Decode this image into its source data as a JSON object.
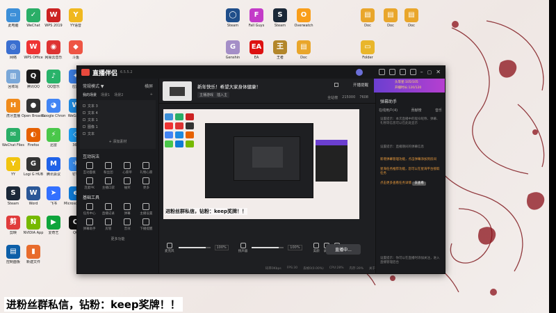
{
  "desktop": {
    "icons": [
      {
        "label": "此电脑",
        "color": "#3c8fd8",
        "glyph": "▭"
      },
      {
        "label": "WeChat",
        "color": "#2aae67",
        "glyph": "✓"
      },
      {
        "label": "WPS 2019",
        "color": "#c22",
        "glyph": "W"
      },
      {
        "label": "YY语音",
        "color": "#f0b81f",
        "glyph": "Y"
      },
      {
        "label": "网络",
        "color": "#3b6fd0",
        "glyph": "◎"
      },
      {
        "label": "WPS Office",
        "color": "#e33",
        "glyph": "W"
      },
      {
        "label": "网易云音乐",
        "color": "#d33",
        "glyph": "◉"
      },
      {
        "label": "斗鱼",
        "color": "#e54",
        "glyph": "◆"
      },
      {
        "label": "回收站",
        "color": "#7aa7d8",
        "glyph": "▥"
      },
      {
        "label": "腾讯QQ",
        "color": "#1b1b1b",
        "glyph": "Q"
      },
      {
        "label": "QQ音乐",
        "color": "#29b36a",
        "glyph": "♪"
      },
      {
        "label": "应用",
        "color": "#3b7de0",
        "glyph": "✦"
      },
      {
        "label": "虎牙直播",
        "color": "#f08a1a",
        "glyph": "H"
      },
      {
        "label": "Open Broadcaster",
        "color": "#333",
        "glyph": "●"
      },
      {
        "label": "Google Chrome",
        "color": "#4285f4",
        "glyph": "◕"
      },
      {
        "label": "WeGame",
        "color": "#1e8ae0",
        "glyph": "W"
      },
      {
        "label": "WeChat Files",
        "color": "#2aae67",
        "glyph": "✉"
      },
      {
        "label": "Firefox",
        "color": "#e66000",
        "glyph": "◐"
      },
      {
        "label": "迅雷",
        "color": "#4ac74a",
        "glyph": "⚡"
      },
      {
        "label": "360",
        "color": "#1f9cf0",
        "glyph": "◇"
      },
      {
        "label": "YY",
        "color": "#f1c40f",
        "glyph": "Y"
      },
      {
        "label": "Logi G HUB",
        "color": "#333",
        "glyph": "G"
      },
      {
        "label": "腾讯会议",
        "color": "#2062e8",
        "glyph": "M"
      },
      {
        "label": "钉钉",
        "color": "#3a8ef0",
        "glyph": "✈"
      },
      {
        "label": "Steam",
        "color": "#1b2838",
        "glyph": "S"
      },
      {
        "label": "Word",
        "color": "#2b5797",
        "glyph": "W"
      },
      {
        "label": "飞书",
        "color": "#3370ff",
        "glyph": "➤"
      },
      {
        "label": "Microsoft Edge",
        "color": "#0f7bd6",
        "glyph": "e"
      },
      {
        "label": "剪映",
        "color": "#e03c3c",
        "glyph": "剪"
      },
      {
        "label": "NVIDIA App",
        "color": "#76b900",
        "glyph": "N"
      },
      {
        "label": "爱奇艺",
        "color": "#0fa53c",
        "glyph": "▶"
      },
      {
        "label": "QQ",
        "color": "#111",
        "glyph": "Q"
      },
      {
        "label": "控制面板",
        "color": "#0d5fa8",
        "glyph": "▤"
      },
      {
        "label": "新建文件",
        "color": "#e86b2c",
        "glyph": "▮"
      },
      {
        "label": "Steam",
        "color": "#1f4e8a",
        "glyph": "◯"
      },
      {
        "label": "Fall Guys",
        "color": "#c33bc8",
        "glyph": "F"
      },
      {
        "label": "Steam",
        "color": "#1b2838",
        "glyph": "S"
      },
      {
        "label": "Overwatch",
        "color": "#f99e1a",
        "glyph": "O"
      },
      {
        "label": "Genshin",
        "color": "#a48ec7",
        "glyph": "G"
      },
      {
        "label": "EA",
        "color": "#d11",
        "glyph": "EA"
      },
      {
        "label": "王者",
        "color": "#b3862a",
        "glyph": "王"
      },
      {
        "label": "Doc",
        "color": "#e9a62b",
        "glyph": "▤"
      },
      {
        "label": "Doc",
        "color": "#e9a62b",
        "glyph": "▤"
      },
      {
        "label": "Doc",
        "color": "#e9a62b",
        "glyph": "▤"
      },
      {
        "label": "Doc",
        "color": "#e9a62b",
        "glyph": "▤"
      },
      {
        "label": "Folder",
        "color": "#e9b62b",
        "glyph": "▭"
      }
    ],
    "bottom_caption": "进粉丝群私信，钻粉：keep奖牌！！"
  },
  "app": {
    "title": "直播伴侣",
    "version": "6.5.5.2",
    "mode": "常规模式 ▼",
    "mode_right": "横屏",
    "scene_tabs": [
      "我的场景",
      "场景1",
      "场景2",
      "+"
    ],
    "sources": [
      "文本 3",
      "文本 4",
      "文本 1",
      "图像 1",
      "文本"
    ],
    "add_source": "+ 添加素材",
    "interactive_header": "互动玩法",
    "interactive_tools": [
      "互动面板",
      "粉丝团",
      "心愿单",
      "礼物心愿",
      "连麦PK",
      "主播口袋",
      "抽奖",
      "更多"
    ],
    "basic_header": "基础工具",
    "basic_tools": [
      "任务中心",
      "直播记录",
      "弹幕",
      "主播设置",
      "弹幕助手",
      "房管",
      "音效",
      "下播提醒"
    ],
    "more_label": "更多功能",
    "stream_title": "新年快乐！希望大家身体健康！",
    "tags": [
      "主播游戏",
      "插入主"
    ],
    "open_live": "开播提醒",
    "share": "分享",
    "stats": [
      "全站榜",
      "215000",
      "7608"
    ],
    "preview_caption": "进粉丝群私信，钻粉：keep奖牌！！",
    "mic_label": "麦克风",
    "mic_value": 0.85,
    "mic_pct": "100%",
    "spk_label": "扬声器",
    "spk_value": 0.85,
    "spk_pct": "100%",
    "bottom_tools": [
      "美颜",
      "录制",
      "设置"
    ],
    "live_button": "直播中...",
    "status": [
      "码率0Kbps",
      "FPS:30",
      "丢帧0(0.00%)",
      "CPU:28%",
      "内存:39%",
      "关于"
    ],
    "banner_lines": [
      "头等星:105/105",
      "开播时长:120/120"
    ],
    "rp_head": "弹幕助手",
    "rp_tabs": [
      "在线用户(4)",
      "贡献榜",
      "音乐"
    ],
    "rp_lines": [
      "设置提示：本次直播中的观众昵称、弹幕、礼物等信息可以在此处显示",
      "设置提示：直播期间的弹幕信息",
      "新增弹幕管理功能，点击弹幕添加到房间",
      "星海任务推荐功能，您可以在星海平台接取任务",
      "点击更多查看任务详情",
      "设置提示：你可以在直播时添加关注，进入直播管理后台"
    ],
    "goto": "去查看",
    "colors": {
      "accent": "#e8493d",
      "window_bg": "#1e1f22",
      "banner": "#7a3fd0",
      "highlight": "#e89a3c"
    }
  }
}
